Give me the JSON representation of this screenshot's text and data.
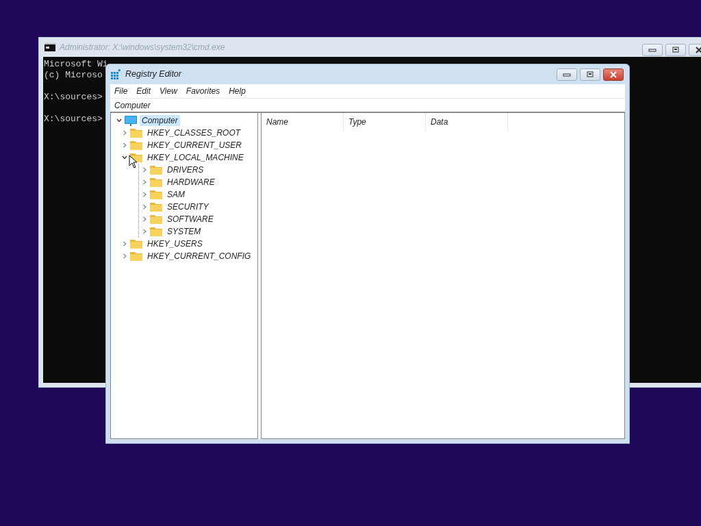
{
  "console_window": {
    "title": "Administrator: X:\\windows\\system32\\cmd.exe",
    "lines": [
      "Microsoft Wi",
      "(c) Microso",
      "X:\\sources>",
      "X:\\sources>"
    ]
  },
  "registry_window": {
    "title": "Registry Editor",
    "menu": [
      "File",
      "Edit",
      "View",
      "Favorites",
      "Help"
    ],
    "address": "Computer",
    "tree": [
      {
        "label": "Computer",
        "kind": "computer",
        "selected": true,
        "expanded": true,
        "children": [
          {
            "label": "HKEY_CLASSES_ROOT",
            "kind": "folder",
            "selected": false,
            "expanded": false
          },
          {
            "label": "HKEY_CURRENT_USER",
            "kind": "folder",
            "selected": false,
            "expanded": false
          },
          {
            "label": "HKEY_LOCAL_MACHINE",
            "kind": "folder",
            "selected": false,
            "expanded": true,
            "children": [
              {
                "label": "DRIVERS",
                "kind": "folder",
                "selected": false,
                "expanded": false
              },
              {
                "label": "HARDWARE",
                "kind": "folder",
                "selected": false,
                "expanded": false
              },
              {
                "label": "SAM",
                "kind": "folder",
                "selected": false,
                "expanded": false
              },
              {
                "label": "SECURITY",
                "kind": "folder",
                "selected": false,
                "expanded": false
              },
              {
                "label": "SOFTWARE",
                "kind": "folder",
                "selected": false,
                "expanded": false
              },
              {
                "label": "SYSTEM",
                "kind": "folder",
                "selected": false,
                "expanded": false
              }
            ]
          },
          {
            "label": "HKEY_USERS",
            "kind": "folder",
            "selected": false,
            "expanded": false
          },
          {
            "label": "HKEY_CURRENT_CONFIG",
            "kind": "folder",
            "selected": false,
            "expanded": false
          }
        ]
      }
    ],
    "columns": [
      "Name",
      "Type",
      "Data"
    ]
  }
}
